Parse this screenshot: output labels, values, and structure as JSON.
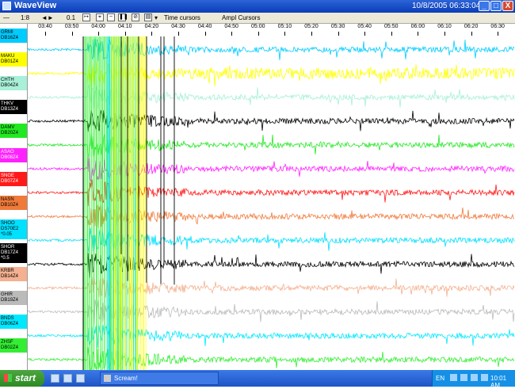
{
  "window": {
    "title": "WaveView",
    "datetime": "10/8/2005 06:33:04",
    "minimize": "_",
    "maximize": "□",
    "close": "X"
  },
  "toolbar": {
    "zoom_ratio": "1:8",
    "step": "0.1",
    "time_cursors": "Time cursors",
    "ampl_cursors": "Ampl Cursors"
  },
  "time_axis": {
    "ticks": [
      "03:40",
      "03:50",
      "04:00",
      "04:10",
      "04:20",
      "04:30",
      "04:40",
      "04:50",
      "05:00",
      "05:10",
      "05:20",
      "05:30",
      "05:40",
      "05:50",
      "06:00",
      "06:10",
      "06:20",
      "06:30"
    ]
  },
  "stations": [
    {
      "name": "GRMI",
      "channel": "DB16Z4",
      "scale": "",
      "color": "#00ccff"
    },
    {
      "name": "MAKU",
      "channel": "DB01Z4",
      "scale": "",
      "color": "#ffff00"
    },
    {
      "name": "CHTH",
      "channel": "DB04Z4",
      "scale": "",
      "color": "#a8f0d8"
    },
    {
      "name": "THKV",
      "channel": "DB13Z4",
      "scale": "",
      "color": "#000000"
    },
    {
      "name": "DAMV",
      "channel": "DB20Z4",
      "scale": "",
      "color": "#22e822"
    },
    {
      "name": "ASAO",
      "channel": "DB08Z4",
      "scale": "",
      "color": "#ff22ff"
    },
    {
      "name": "SNGE",
      "channel": "DB07Z4",
      "scale": "",
      "color": "#ff1a1a"
    },
    {
      "name": "NASN",
      "channel": "DB10Z4",
      "scale": "",
      "color": "#f07a3a"
    },
    {
      "name": "SHOO",
      "channel": "DS70E2",
      "scale": "*0.05",
      "color": "#00e0ff"
    },
    {
      "name": "SHOR",
      "channel": "DB17Z4",
      "scale": "*0.5",
      "color": "#000000"
    },
    {
      "name": "KRBR",
      "channel": "DB14Z4",
      "scale": "",
      "color": "#f4b090"
    },
    {
      "name": "GHIR",
      "channel": "DB19Z4",
      "scale": "",
      "color": "#bbbbbb"
    },
    {
      "name": "BNDS",
      "channel": "DB06Z4",
      "scale": "",
      "color": "#00e8ff"
    },
    {
      "name": "ZHSF",
      "channel": "DB02Z4",
      "scale": "",
      "color": "#33ee33"
    }
  ],
  "taskbar": {
    "start": "start",
    "task": "Scream!",
    "lang": "EN",
    "time": "10:01 AM"
  }
}
